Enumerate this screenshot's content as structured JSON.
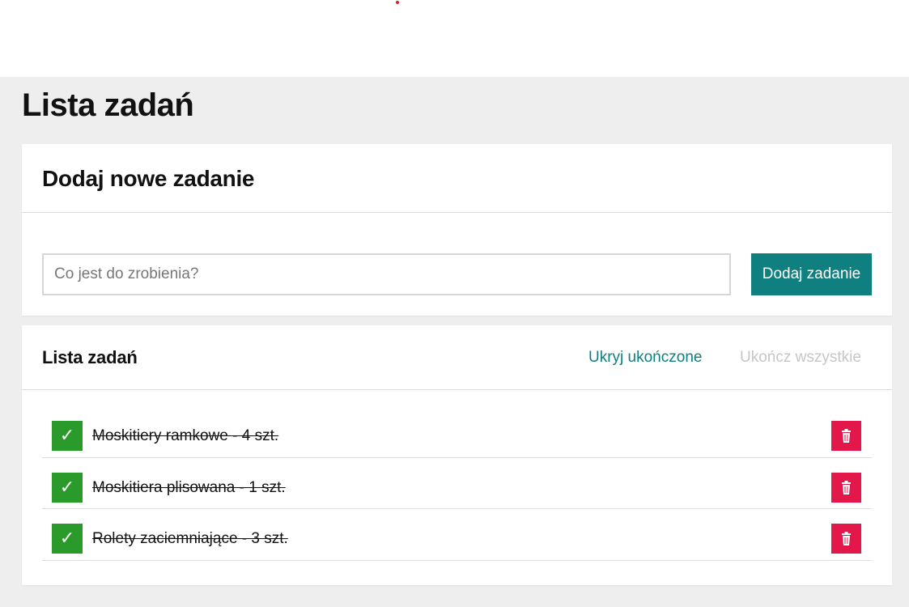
{
  "page": {
    "title": "Lista zadań"
  },
  "add_card": {
    "title": "Dodaj nowe zadanie",
    "input_placeholder": "Co jest do zrobienia?",
    "input_value": "",
    "button_label": "Dodaj zadanie"
  },
  "list_card": {
    "title": "Lista zadań",
    "hide_completed_label": "Ukryj ukończone",
    "complete_all_label": "Ukończ wszystkie",
    "tasks": [
      {
        "text": "Moskitiery ramkowe - 4 szt.",
        "completed": true,
        "check_glyph": "✓"
      },
      {
        "text": "Moskitiera plisowana - 1 szt.",
        "completed": true,
        "check_glyph": "✓"
      },
      {
        "text": "Rolety zaciemniające - 3 szt.",
        "completed": true,
        "check_glyph": "✓"
      }
    ]
  },
  "colors": {
    "accent": "#0f7f80",
    "check": "#2a9a2a",
    "delete": "#e3174a",
    "disabled_link": "#c6c6c6",
    "page_background": "#eeeeee"
  },
  "icons": {
    "check": "check-icon",
    "delete": "trash-icon"
  }
}
